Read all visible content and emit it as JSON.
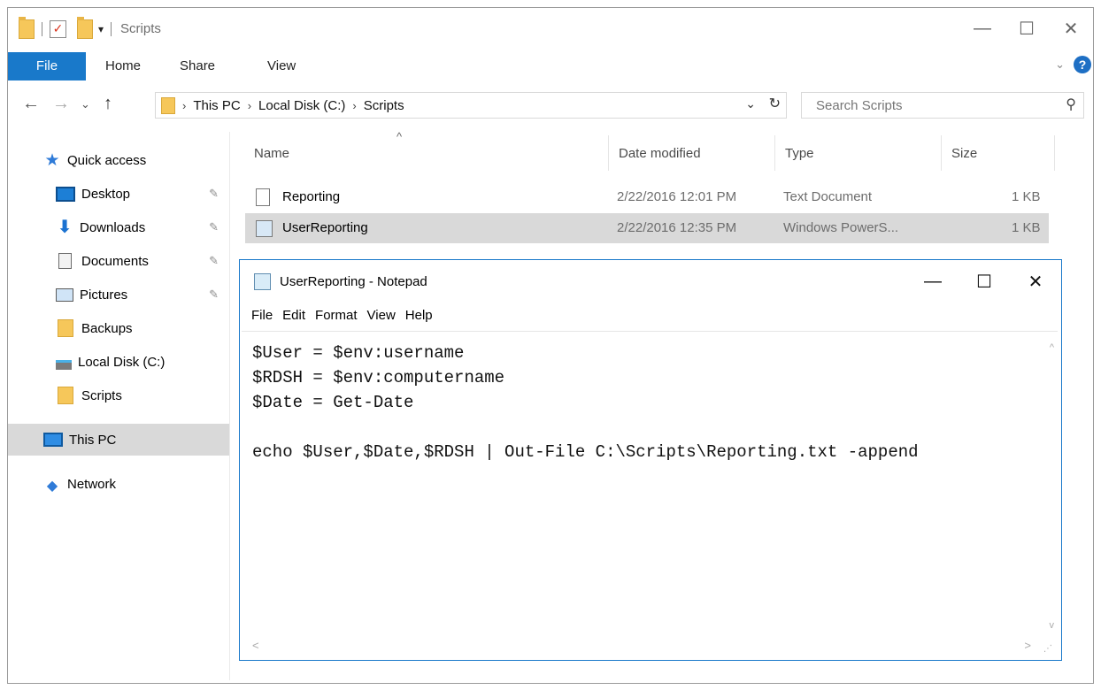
{
  "window": {
    "title": "Scripts",
    "minimize_glyph": "—",
    "maximize_glyph": "☐",
    "close_glyph": "✕"
  },
  "ribbon": {
    "tabs": [
      "File",
      "Home",
      "Share",
      "View"
    ]
  },
  "address": {
    "crumbs": [
      "This PC",
      "Local Disk (C:)",
      "Scripts"
    ],
    "search_placeholder": "Search Scripts"
  },
  "nav_pane": {
    "items": [
      {
        "label": "Quick access",
        "icon": "star-icon"
      },
      {
        "label": "Desktop",
        "icon": "desktop-icon",
        "pinned": true
      },
      {
        "label": "Downloads",
        "icon": "download-icon",
        "pinned": true
      },
      {
        "label": "Documents",
        "icon": "documents-icon",
        "pinned": true
      },
      {
        "label": "Pictures",
        "icon": "pictures-icon",
        "pinned": true
      },
      {
        "label": "Backups",
        "icon": "folder-icon"
      },
      {
        "label": "Local Disk (C:)",
        "icon": "disk-icon"
      },
      {
        "label": "Scripts",
        "icon": "folder-icon"
      },
      {
        "label": "This PC",
        "icon": "pc-icon",
        "selected": true
      },
      {
        "label": "Network",
        "icon": "network-icon"
      }
    ]
  },
  "file_list": {
    "columns": [
      "Name",
      "Date modified",
      "Type",
      "Size"
    ],
    "rows": [
      {
        "name": "Reporting",
        "date": "2/22/2016 12:01 PM",
        "type": "Text Document",
        "size": "1 KB",
        "icon": "text-file-icon"
      },
      {
        "name": "UserReporting",
        "date": "2/22/2016 12:35 PM",
        "type": "Windows PowerS...",
        "size": "1 KB",
        "icon": "powershell-file-icon",
        "selected": true
      }
    ]
  },
  "notepad": {
    "title": "UserReporting - Notepad",
    "menu": [
      "File",
      "Edit",
      "Format",
      "View",
      "Help"
    ],
    "lines": [
      "$User = $env:username",
      "$RDSH = $env:computername",
      "$Date = Get-Date",
      "",
      "echo $User,$Date,$RDSH | Out-File C:\\Scripts\\Reporting.txt -append"
    ]
  },
  "colors": {
    "accent": "#1979ca",
    "selection": "#d9d9d9"
  }
}
